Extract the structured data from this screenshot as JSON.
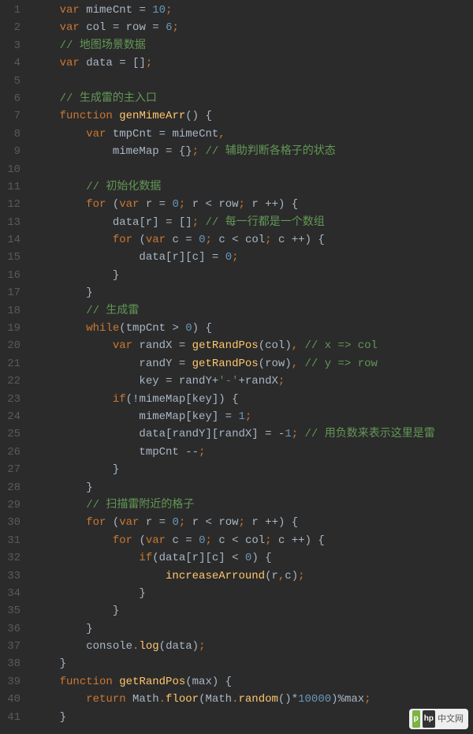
{
  "line_count": 41,
  "code": {
    "l1": {
      "kw1": "var",
      "id1": " mimeCnt ",
      "op1": "= ",
      "num1": "10",
      "p1": ";"
    },
    "l2": {
      "kw1": "var",
      "id1": " col ",
      "op1": "= ",
      "id2": "row ",
      "op2": "= ",
      "num1": "6",
      "p1": ";"
    },
    "l3": {
      "cmt": "// 地图场景数据"
    },
    "l4": {
      "kw1": "var",
      "id1": " data ",
      "op1": "= ",
      "par": "[]",
      "p1": ";"
    },
    "l5": {
      "blank": ""
    },
    "l6": {
      "cmt": "// 生成雷的主入口"
    },
    "l7": {
      "kw1": "function ",
      "fn": "genMimeArr",
      "par": "() {"
    },
    "l8": {
      "kw1": "var",
      "id1": " tmpCnt ",
      "op1": "= ",
      "id2": "mimeCnt",
      "p1": ","
    },
    "l9": {
      "id1": "mimeMap ",
      "op1": "= ",
      "par": "{}",
      "p1": "; ",
      "cmt": "// 辅助判断各格子的状态"
    },
    "l10": {
      "blank": ""
    },
    "l11": {
      "cmt": "// 初始化数据"
    },
    "l12": {
      "kw1": "for ",
      "par1": "(",
      "kw2": "var",
      "id1": " r ",
      "op1": "= ",
      "num1": "0",
      "p1": "; ",
      "id2": "r ",
      "op2": "< ",
      "id3": "row",
      "p2": "; ",
      "id4": "r ",
      "op3": "++",
      "par2": ") {"
    },
    "l13": {
      "id1": "data",
      "par1": "[",
      "id2": "r",
      "par2": "] ",
      "op1": "= ",
      "par3": "[]",
      "p1": "; ",
      "cmt": "// 每一行都是一个数组"
    },
    "l14": {
      "kw1": "for ",
      "par1": "(",
      "kw2": "var",
      "id1": " c ",
      "op1": "= ",
      "num1": "0",
      "p1": "; ",
      "id2": "c ",
      "op2": "< ",
      "id3": "col",
      "p2": "; ",
      "id4": "c ",
      "op3": "++",
      "par2": ") {"
    },
    "l15": {
      "id1": "data",
      "par1": "[",
      "id2": "r",
      "par2": "][",
      "id3": "c",
      "par3": "] ",
      "op1": "= ",
      "num1": "0",
      "p1": ";"
    },
    "l16": {
      "par": "}"
    },
    "l17": {
      "par": "}"
    },
    "l18": {
      "cmt": "// 生成雷"
    },
    "l19": {
      "kw1": "while",
      "par1": "(",
      "id1": "tmpCnt ",
      "op1": "> ",
      "num1": "0",
      "par2": ") {"
    },
    "l20": {
      "kw1": "var",
      "id1": " randX ",
      "op1": "= ",
      "fn": "getRandPos",
      "par1": "(",
      "id2": "col",
      "par2": ")",
      "p1": ", ",
      "cmt": "// x => col"
    },
    "l21": {
      "id1": "randY ",
      "op1": "= ",
      "fn": "getRandPos",
      "par1": "(",
      "id2": "row",
      "par2": ")",
      "p1": ", ",
      "cmt": "// y => row"
    },
    "l22": {
      "id1": "key ",
      "op1": "= ",
      "id2": "randY",
      "op2": "+",
      "str": "'-'",
      "op3": "+",
      "id3": "randX",
      "p1": ";"
    },
    "l23": {
      "kw1": "if",
      "par1": "(!",
      "id1": "mimeMap",
      "par2": "[",
      "id2": "key",
      "par3": "]) {"
    },
    "l24": {
      "id1": "mimeMap",
      "par1": "[",
      "id2": "key",
      "par2": "] ",
      "op1": "= ",
      "num1": "1",
      "p1": ";"
    },
    "l25": {
      "id1": "data",
      "par1": "[",
      "id2": "randY",
      "par2": "][",
      "id3": "randX",
      "par3": "] ",
      "op1": "= ",
      "op2": "-",
      "num1": "1",
      "p1": "; ",
      "cmt": "// 用负数来表示这里是雷"
    },
    "l26": {
      "id1": "tmpCnt ",
      "op1": "--",
      "p1": ";"
    },
    "l27": {
      "par": "}"
    },
    "l28": {
      "par": "}"
    },
    "l29": {
      "cmt": "// 扫描雷附近的格子"
    },
    "l30": {
      "kw1": "for ",
      "par1": "(",
      "kw2": "var",
      "id1": " r ",
      "op1": "= ",
      "num1": "0",
      "p1": "; ",
      "id2": "r ",
      "op2": "< ",
      "id3": "row",
      "p2": "; ",
      "id4": "r ",
      "op3": "++",
      "par2": ") {"
    },
    "l31": {
      "kw1": "for ",
      "par1": "(",
      "kw2": "var",
      "id1": " c ",
      "op1": "= ",
      "num1": "0",
      "p1": "; ",
      "id2": "c ",
      "op2": "< ",
      "id3": "col",
      "p2": "; ",
      "id4": "c ",
      "op3": "++",
      "par2": ") {"
    },
    "l32": {
      "kw1": "if",
      "par1": "(",
      "id1": "data",
      "par2": "[",
      "id2": "r",
      "par3": "][",
      "id3": "c",
      "par4": "] ",
      "op1": "< ",
      "num1": "0",
      "par5": ") {"
    },
    "l33": {
      "fn": "increaseArround",
      "par1": "(",
      "id1": "r",
      "p1": ",",
      "id2": "c",
      "par2": ")",
      "p2": ";"
    },
    "l34": {
      "par": "}"
    },
    "l35": {
      "par": "}"
    },
    "l36": {
      "par": "}"
    },
    "l37": {
      "id1": "console",
      "p1": ".",
      "fn": "log",
      "par1": "(",
      "id2": "data",
      "par2": ")",
      "p2": ";"
    },
    "l38": {
      "par": "}"
    },
    "l39": {
      "kw1": "function ",
      "fn": "getRandPos",
      "par1": "(",
      "id1": "max",
      "par2": ") {"
    },
    "l40": {
      "kw1": "return ",
      "id1": "Math",
      "p1": ".",
      "fn1": "floor",
      "par1": "(",
      "id2": "Math",
      "p2": ".",
      "fn2": "random",
      "par2": "()",
      "op1": "*",
      "num1": "10000",
      "par3": ")",
      "op2": "%",
      "id3": "max",
      "p3": ";"
    },
    "l41": {
      "par": "}"
    }
  },
  "indents": {
    "l1": 4,
    "l2": 4,
    "l3": 4,
    "l4": 4,
    "l5": 0,
    "l6": 4,
    "l7": 4,
    "l8": 8,
    "l9": 12,
    "l10": 0,
    "l11": 8,
    "l12": 8,
    "l13": 12,
    "l14": 12,
    "l15": 16,
    "l16": 12,
    "l17": 8,
    "l18": 8,
    "l19": 8,
    "l20": 12,
    "l21": 16,
    "l22": 16,
    "l23": 12,
    "l24": 16,
    "l25": 16,
    "l26": 16,
    "l27": 12,
    "l28": 8,
    "l29": 8,
    "l30": 8,
    "l31": 12,
    "l32": 16,
    "l33": 20,
    "l34": 16,
    "l35": 12,
    "l36": 8,
    "l37": 8,
    "l38": 4,
    "l39": 4,
    "l40": 8,
    "l41": 4
  },
  "watermark": {
    "logo1": "p",
    "logo2": "hp",
    "text": "中文网"
  }
}
